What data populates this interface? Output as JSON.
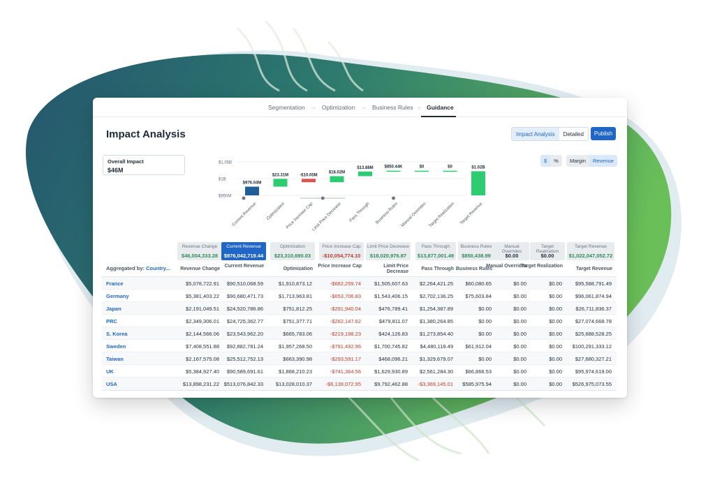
{
  "stepper": {
    "steps": [
      "Segmentation",
      "Optimization",
      "Business Rules",
      "Guidance"
    ],
    "active": "Guidance"
  },
  "page": {
    "title": "Impact Analysis"
  },
  "view_toggle": {
    "options": [
      "Impact Analysis",
      "Detailed"
    ],
    "selected": "Impact Analysis"
  },
  "publish_label": "Publish",
  "overall": {
    "label": "Overall Impact",
    "value": "$46M"
  },
  "unit_toggle": {
    "options": [
      "$",
      "%"
    ],
    "selected": "$"
  },
  "metric_toggle": {
    "options": [
      "Margin",
      "Revenue"
    ],
    "selected": "Revenue"
  },
  "colors": {
    "accent": "#1f66c7",
    "positive": "#2ecc71",
    "negative": "#e05252",
    "current": "#1f5f99",
    "neg_text": "#c0392b"
  },
  "chart_data": {
    "type": "bar",
    "subtype": "waterfall",
    "y_ticks": [
      "$1.05B",
      "$1B",
      "$950M"
    ],
    "categories": [
      "Current Revenue",
      "Optimization",
      "Price Increase Cap",
      "Limit Price Decrease",
      "Pass Through",
      "Business Rules",
      "Manual Overrides",
      "Target Realization",
      "Target Revenue"
    ],
    "values": [
      976042719.44,
      23310690.03,
      -10054774.1,
      18020976.87,
      13877001.49,
      850438.99,
      0,
      0,
      1022047052.72
    ],
    "data_labels": [
      "$976.04M",
      "$23.31M",
      "-$10.05M",
      "$18.02M",
      "$13.88M",
      "$850.44K",
      "$0",
      "$0",
      "$1.02B"
    ],
    "ylim": [
      950000000,
      1050000000
    ]
  },
  "summary": [
    {
      "label": "Revenue Change",
      "value": "$46,004,333.28"
    },
    {
      "label": "Current Revenue",
      "value": "$976,042,719.44"
    },
    {
      "label": "Optimization",
      "value": "$23,310,690.03"
    },
    {
      "label": "Price Increase Cap",
      "value": "-$10,054,774.10"
    },
    {
      "label": "Limit Price Decrease",
      "value": "$18,020,976.87"
    },
    {
      "label": "Pass Through",
      "value": "$13,877,001.49"
    },
    {
      "label": "Business Rules",
      "value": "$850,438.99"
    },
    {
      "label": "Manual Overrides",
      "value": "$0.00"
    },
    {
      "label": "Target Realization",
      "value": "$0.00"
    },
    {
      "label": "Target Revenue",
      "value": "$1,022,047,052.72"
    }
  ],
  "aggregated_by": {
    "label": "Aggregated by:",
    "value": "Country..."
  },
  "columns": [
    "Revenue Change",
    "Current Revenue",
    "Optimization",
    "Price Increase Cap",
    "Limit Price Decrease",
    "Pass Through",
    "Business Rules",
    "Manual Overrides",
    "Target Realization",
    "Target Revenue"
  ],
  "rows": [
    [
      "France",
      "$5,078,722.91",
      "$90,510,068.59",
      "$1,910,873.12",
      "-$662,259.74",
      "$1,505,607.63",
      "$2,264,421.25",
      "$60,080.65",
      "$0.00",
      "$0.00",
      "$95,588,791.49"
    ],
    [
      "Germany",
      "$5,381,403.22",
      "$90,680,471.73",
      "$1,713,963.81",
      "-$653,706.83",
      "$1,543,406.15",
      "$2,702,136.25",
      "$75,603.84",
      "$0.00",
      "$0.00",
      "$96,061,874.94"
    ],
    [
      "Japan",
      "$2,191,049.51",
      "$24,520,786.86",
      "$751,812.25",
      "-$291,940.04",
      "$476,789.41",
      "$1,254,387.89",
      "$0.00",
      "$0.00",
      "$0.00",
      "$26,711,836.37"
    ],
    [
      "PRC",
      "$2,349,306.01",
      "$24,725,362.77",
      "$751,377.71",
      "-$262,147.62",
      "$479,811.07",
      "$1,380,264.85",
      "$0.00",
      "$0.00",
      "$0.00",
      "$27,074,668.78"
    ],
    [
      "S. Korea",
      "$2,144,566.06",
      "$23,543,962.20",
      "$665,783.06",
      "-$219,198.23",
      "$424,126.83",
      "$1,273,854.40",
      "$0.00",
      "$0.00",
      "$0.00",
      "$25,688,528.25"
    ],
    [
      "Sweden",
      "$7,408,551.88",
      "$92,882,781.24",
      "$1,957,268.50",
      "-$791,492.96",
      "$1,700,745.82",
      "$4,480,118.49",
      "$61,912.04",
      "$0.00",
      "$0.00",
      "$100,291,333.12"
    ],
    [
      "Taiwan",
      "$2,167,575.08",
      "$25,512,752.13",
      "$663,390.98",
      "-$293,591.17",
      "$468,096.21",
      "$1,329,679.07",
      "$0.00",
      "$0.00",
      "$0.00",
      "$27,680,327.21"
    ],
    [
      "UK",
      "$5,384,927.40",
      "$90,589,691.61",
      "$1,868,210.23",
      "-$741,364.56",
      "$1,629,930.89",
      "$2,561,284.30",
      "$66,866.53",
      "$0.00",
      "$0.00",
      "$95,974,619.00"
    ],
    [
      "USA",
      "$13,898,231.22",
      "$513,076,842.33",
      "$13,028,010.37",
      "-$6,139,072.95",
      "$9,792,462.88",
      "-$3,369,145.01",
      "$585,975.94",
      "$0.00",
      "$0.00",
      "$526,975,073.55"
    ]
  ]
}
